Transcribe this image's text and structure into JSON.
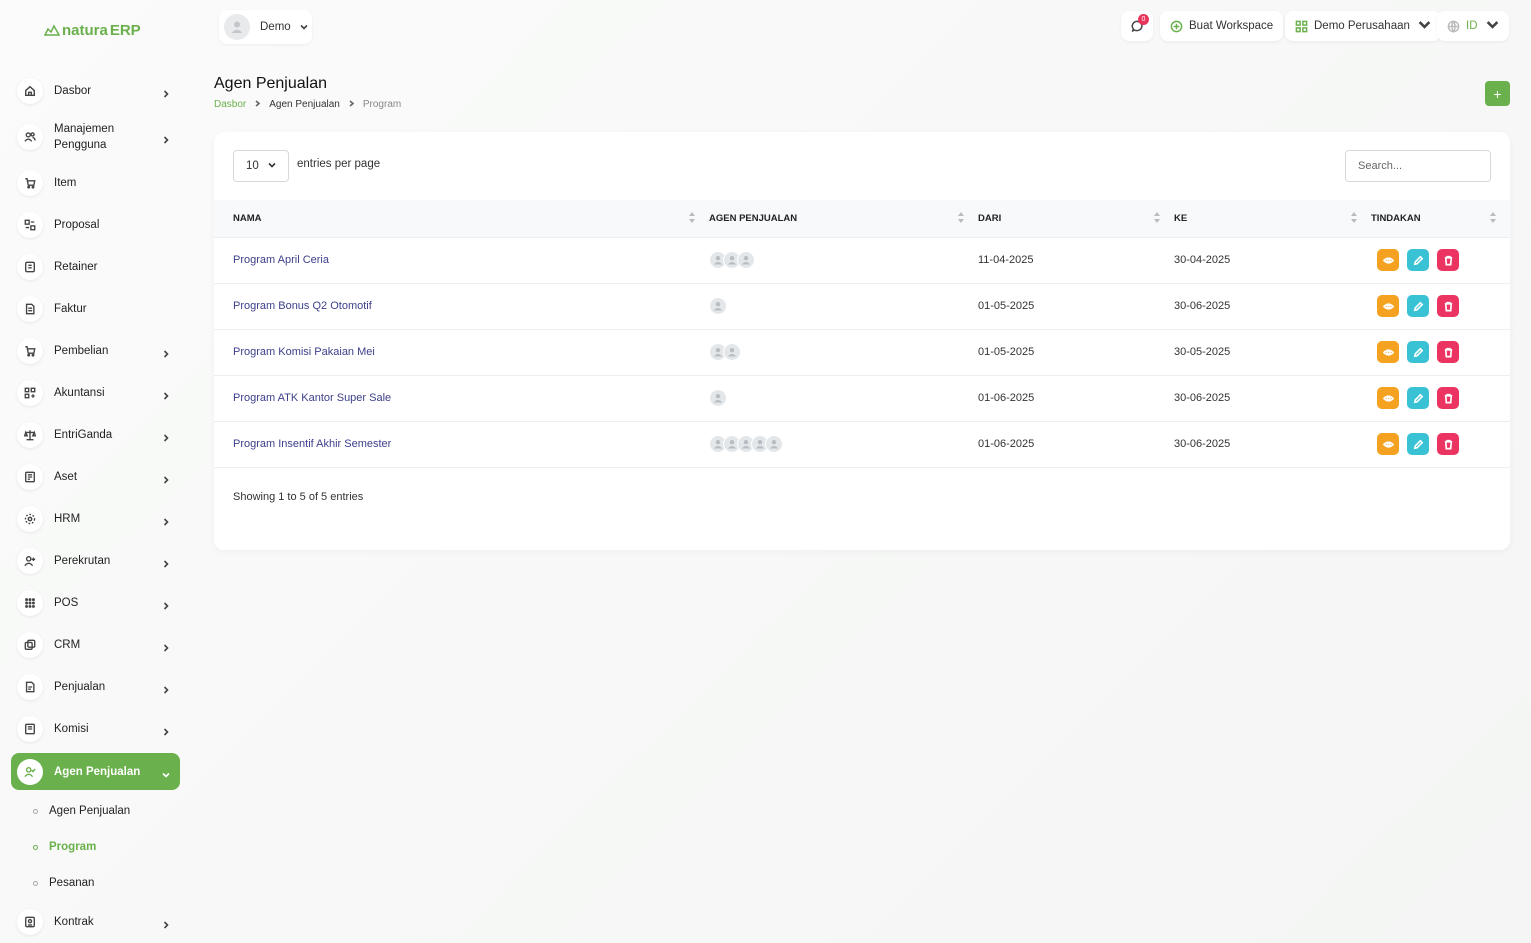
{
  "brand": {
    "name_a": "natura",
    "name_b": "ERP"
  },
  "colors": {
    "accent": "#6ab04c",
    "view": "#f4a21f",
    "edit": "#39c1d4",
    "delete": "#ec3463",
    "link": "#3c3f8a"
  },
  "sidebar": {
    "items": [
      {
        "label": "Dasbor",
        "icon": "home-icon",
        "chevron": true
      },
      {
        "label": "Manajemen Pengguna",
        "icon": "users-icon",
        "chevron": true
      },
      {
        "label": "Item",
        "icon": "cart-icon",
        "chevron": false
      },
      {
        "label": "Proposal",
        "icon": "proposal-icon",
        "chevron": false
      },
      {
        "label": "Retainer",
        "icon": "retainer-icon",
        "chevron": false
      },
      {
        "label": "Faktur",
        "icon": "invoice-icon",
        "chevron": false
      },
      {
        "label": "Pembelian",
        "icon": "cart-icon",
        "chevron": true
      },
      {
        "label": "Akuntansi",
        "icon": "grid-icon",
        "chevron": true
      },
      {
        "label": "EntriGanda",
        "icon": "scale-icon",
        "chevron": true
      },
      {
        "label": "Aset",
        "icon": "asset-icon",
        "chevron": true
      },
      {
        "label": "HRM",
        "icon": "hrm-icon",
        "chevron": true
      },
      {
        "label": "Perekrutan",
        "icon": "user-plus-icon",
        "chevron": true
      },
      {
        "label": "POS",
        "icon": "dots-grid-icon",
        "chevron": true
      },
      {
        "label": "CRM",
        "icon": "crm-icon",
        "chevron": true
      },
      {
        "label": "Penjualan",
        "icon": "file-icon",
        "chevron": true
      },
      {
        "label": "Komisi",
        "icon": "commission-icon",
        "chevron": true
      },
      {
        "label": "Agen Penjualan",
        "icon": "user-check-icon",
        "chevron": true,
        "active": true
      }
    ],
    "submenu": [
      {
        "label": "Agen Penjualan",
        "active": false
      },
      {
        "label": "Program",
        "active": true
      },
      {
        "label": "Pesanan",
        "active": false
      }
    ],
    "last_item": {
      "label": "Kontrak",
      "icon": "contract-icon",
      "chevron": true
    }
  },
  "topbar": {
    "user": "Demo",
    "notification_count": "0",
    "create_workspace": "Buat Workspace",
    "company": "Demo Perusahaan",
    "language": "ID"
  },
  "page": {
    "title": "Agen Penjualan",
    "breadcrumb": [
      "Dasbor",
      "Agen Penjualan",
      "Program"
    ],
    "add_label": "+"
  },
  "table": {
    "entries_value": "10",
    "entries_label": "entries per page",
    "search_placeholder": "Search...",
    "headers": [
      "NAMA",
      "AGEN PENJUALAN",
      "DARI",
      "KE",
      "TINDAKAN"
    ],
    "rows": [
      {
        "name": "Program April Ceria",
        "agents": 3,
        "from": "11-04-2025",
        "to": "30-04-2025"
      },
      {
        "name": "Program Bonus Q2 Otomotif",
        "agents": 1,
        "from": "01-05-2025",
        "to": "30-06-2025"
      },
      {
        "name": "Program Komisi Pakaian Mei",
        "agents": 2,
        "from": "01-05-2025",
        "to": "30-05-2025"
      },
      {
        "name": "Program ATK Kantor Super Sale",
        "agents": 1,
        "from": "01-06-2025",
        "to": "30-06-2025"
      },
      {
        "name": "Program Insentif Akhir Semester",
        "agents": 5,
        "from": "01-06-2025",
        "to": "30-06-2025"
      }
    ],
    "footer": "Showing 1 to 5 of 5 entries"
  }
}
